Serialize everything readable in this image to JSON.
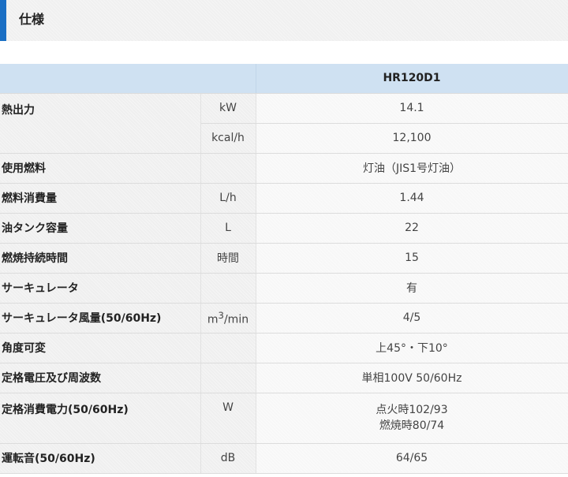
{
  "section": {
    "title": "仕様"
  },
  "table": {
    "model": "HR120D1",
    "rows": [
      {
        "label": "熱出力",
        "unit": "kW",
        "value": "14.1"
      },
      {
        "label": "",
        "unit": "kcal/h",
        "value": "12,100"
      },
      {
        "label": "使用燃料",
        "unit": "",
        "value": "灯油（JIS1号灯油）"
      },
      {
        "label": "燃料消費量",
        "unit": "L/h",
        "value": "1.44"
      },
      {
        "label": "油タンク容量",
        "unit": "L",
        "value": "22"
      },
      {
        "label": "燃焼持続時間",
        "unit": "時間",
        "value": "15"
      },
      {
        "label": "サーキュレータ",
        "unit": "",
        "value": "有"
      },
      {
        "label": "サーキュレータ風量(50/60Hz)",
        "unit_base": "m",
        "unit_sup": "3",
        "unit_rest": "/min",
        "value": "4/5"
      },
      {
        "label": "角度可変",
        "unit": "",
        "value": "上45°・下10°"
      },
      {
        "label": "定格電圧及び周波数",
        "unit": "",
        "value": "単相100V 50/60Hz"
      },
      {
        "label": "定格消費電力(50/60Hz)",
        "unit": "W",
        "value_line1": "点火時102/93",
        "value_line2": "燃焼時80/74"
      },
      {
        "label": "運転音(50/60Hz)",
        "unit": "dB",
        "value": "64/65"
      }
    ]
  }
}
